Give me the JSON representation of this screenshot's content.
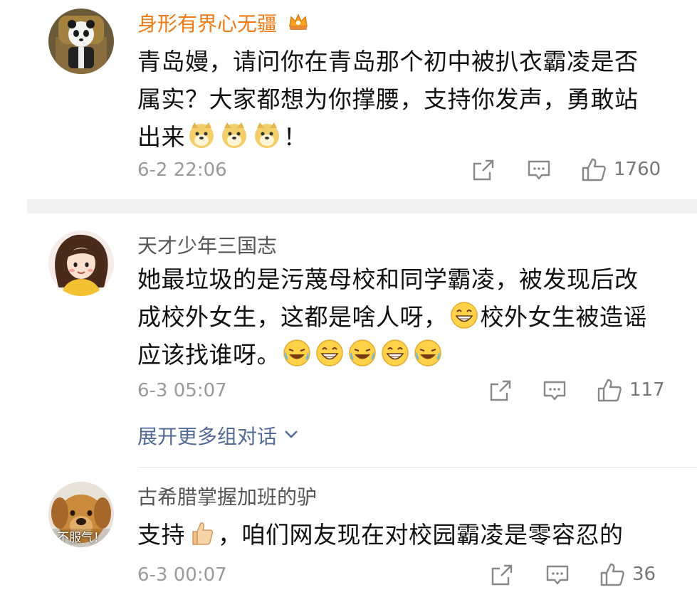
{
  "comments": [
    {
      "username": "身形有界心无疆",
      "text_parts": [
        "青岛嫚，请问你在青岛那个初中被扒衣霸凌是否属实？大家都想为你撑腰，支持你发声，勇敢站出来",
        "！"
      ],
      "time": "6-2 22:06",
      "likes": "1760",
      "avatar": "panda-avatar"
    },
    {
      "username": "天才少年三国志",
      "text_parts": [
        "她最垃圾的是污蔑母校和同学霸凌，被发现后改成校外女生，这都是啥人呀，",
        "校外女生被造谣应该找谁呀。"
      ],
      "time": "6-3 05:07",
      "likes": "117",
      "avatar": "cartoon-girl-avatar"
    },
    {
      "username": "古希腊掌握加班的驴",
      "text_parts": [
        "支持",
        "，咱们网友现在对校园霸凌是零容忍的"
      ],
      "time": "6-3 00:07",
      "likes": "36",
      "avatar": "dog-avatar",
      "avatar_caption": "不服气！"
    }
  ],
  "expand_label": "展开更多组对话",
  "colors": {
    "vip_name": "#f07a13",
    "link": "#516a96",
    "meta": "#9a9a9a"
  },
  "icons": [
    "share-icon",
    "reply-icon",
    "thumbs-up-icon",
    "doge-emoji",
    "grin-emoji",
    "laugh-cry-emoji",
    "thumbs-up-emoji",
    "crown-icon",
    "chevron-down-icon"
  ]
}
